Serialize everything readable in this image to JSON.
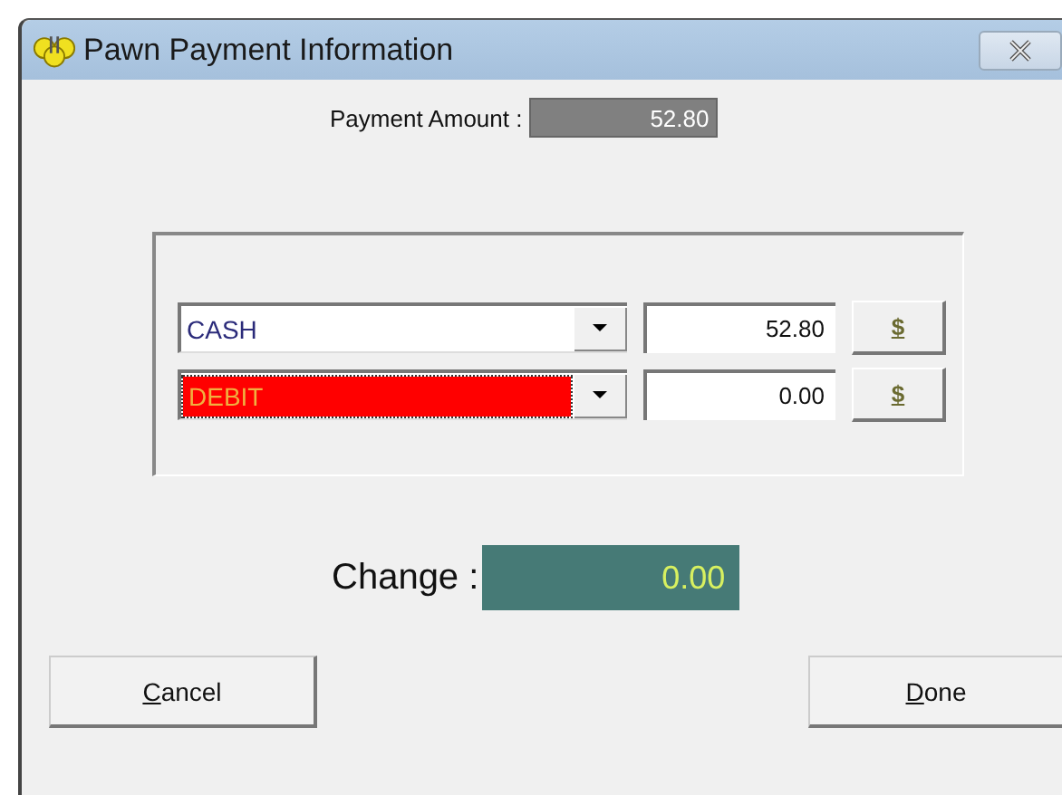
{
  "window": {
    "title": "Pawn Payment Information"
  },
  "payment_amount": {
    "label": "Payment Amount :",
    "value": "52.80"
  },
  "tenders": [
    {
      "method": "CASH",
      "selected": false,
      "amount": "52.80",
      "button": "$"
    },
    {
      "method": "DEBIT",
      "selected": true,
      "amount": "0.00",
      "button": "$"
    }
  ],
  "change": {
    "label": "Change :",
    "value": "0.00"
  },
  "buttons": [
    {
      "label": "Cancel",
      "kind": "cancel",
      "mnemonic_underlined": true
    },
    {
      "label": "Done",
      "kind": "done",
      "mnemonic_underlined": true
    }
  ]
}
